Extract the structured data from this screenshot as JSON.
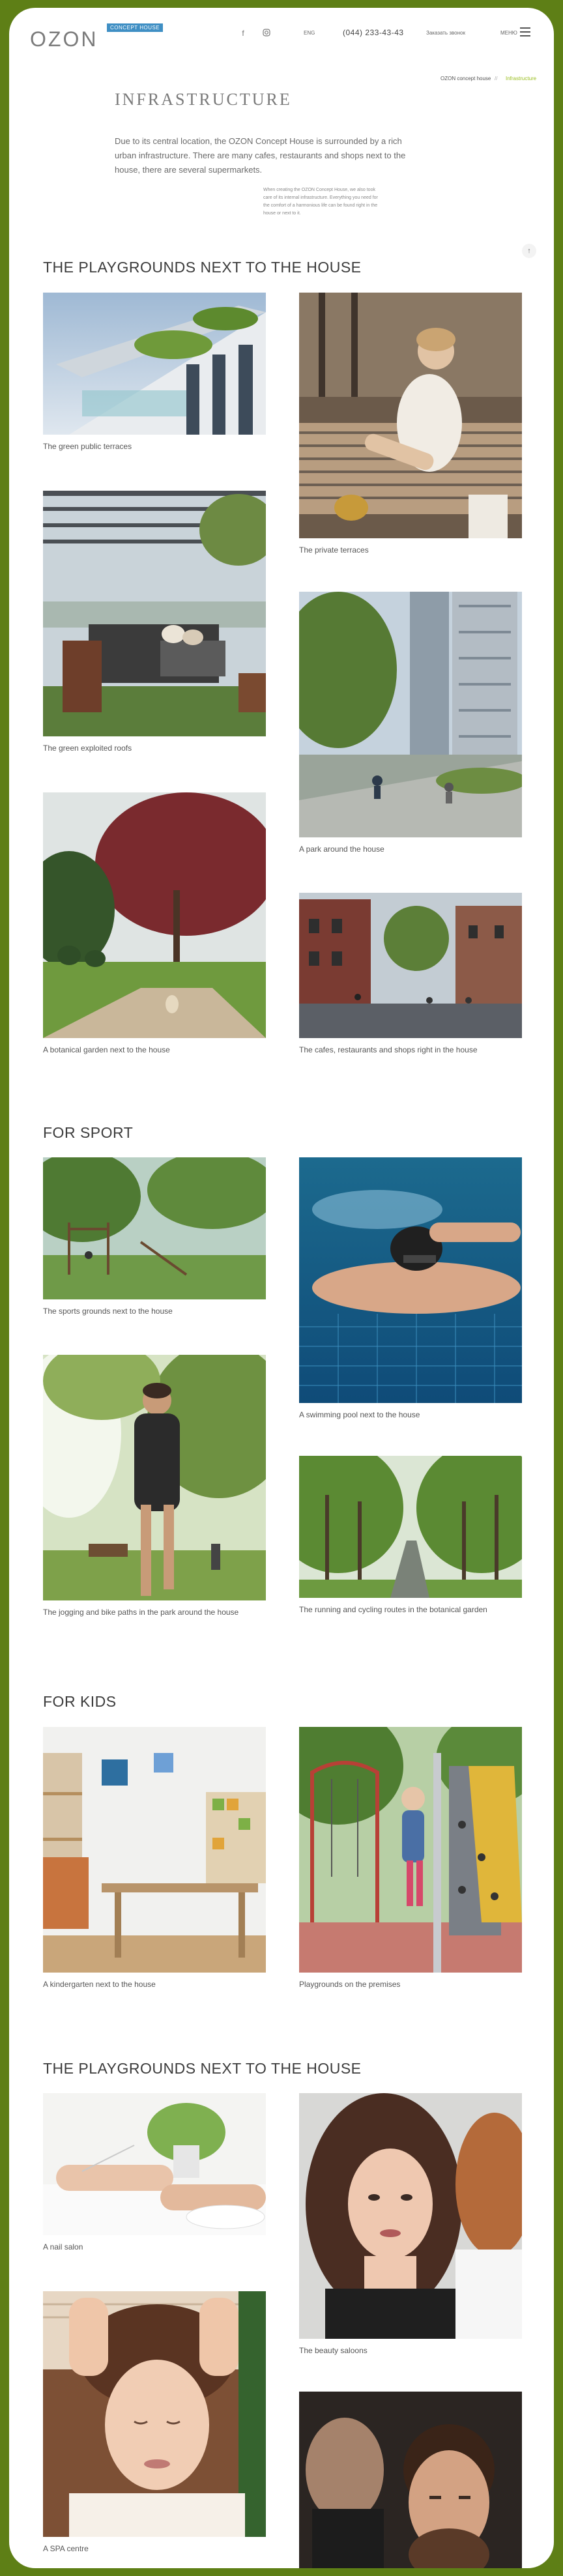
{
  "header": {
    "logo": "OZON",
    "logo_badge": "CONCEPT HOUSE",
    "nav_left": "ENG",
    "phone": "(044) 233-43-43",
    "nav_right": "Заказать звонок",
    "menu_label": "МЕНЮ"
  },
  "breadcrumbs": {
    "parent": "OZON concept house",
    "separator": "//",
    "current": "Infrastructure"
  },
  "intro": {
    "title": "INFRASTRUCTURE",
    "text": "Due to its central location, the OZON Concept House is surrounded by a rich urban infrastructure. There are many cafes, restaurants and shops next to the house, there are several supermarkets.",
    "small_text": "When creating the OZON Concept House, we also took care of its internal infrastructure. Everything you need for the comfort of a harmonious life can be found right in the house or next to it."
  },
  "sections": [
    {
      "title": "THE PLAYGROUNDS NEXT TO THE HOUSE",
      "items": [
        {
          "caption": "The green public terraces",
          "image": "terrace-photo"
        },
        {
          "caption": "The private terraces",
          "image": "woman-on-sofa-photo"
        },
        {
          "caption": "The green exploited roofs",
          "image": "roof-lounge-photo"
        },
        {
          "caption": "A park around the house",
          "image": "park-photo"
        },
        {
          "caption": "A botanical garden next to the house",
          "image": "garden-photo"
        },
        {
          "caption": "The cafes, restaurants and shops right in the house",
          "image": "street-photo"
        }
      ]
    },
    {
      "title": "FOR SPORT",
      "items": [
        {
          "caption": "The sports grounds next to the house",
          "image": "sports-ground-photo"
        },
        {
          "caption": "A swimming pool next to the house",
          "image": "swimmer-photo"
        },
        {
          "caption": "The jogging and bike paths in the park around the house",
          "image": "runner-photo"
        },
        {
          "caption": "The running and cycling routes in the botanical garden",
          "image": "alley-photo"
        }
      ]
    },
    {
      "title": "FOR KIDS",
      "items": [
        {
          "caption": "A kindergarten next to the house",
          "image": "kindergarten-photo"
        },
        {
          "caption": "Playgrounds on the premises",
          "image": "playground-photo"
        }
      ]
    },
    {
      "title": "THE PLAYGROUNDS NEXT TO THE HOUSE",
      "items": [
        {
          "caption": "A nail salon",
          "image": "nail-salon-photo"
        },
        {
          "caption": "The beauty saloons",
          "image": "beauty-salon-photo"
        },
        {
          "caption": "A SPA centre",
          "image": "spa-photo"
        },
        {
          "caption": "",
          "image": "barber-photo"
        }
      ]
    }
  ],
  "colors": {
    "frame_border": "#5e7f16",
    "accent": "#9bbf22",
    "badge": "#3f8fc4"
  },
  "icons": [
    "facebook-icon",
    "instagram-icon",
    "menu-icon",
    "scroll-up-icon"
  ]
}
